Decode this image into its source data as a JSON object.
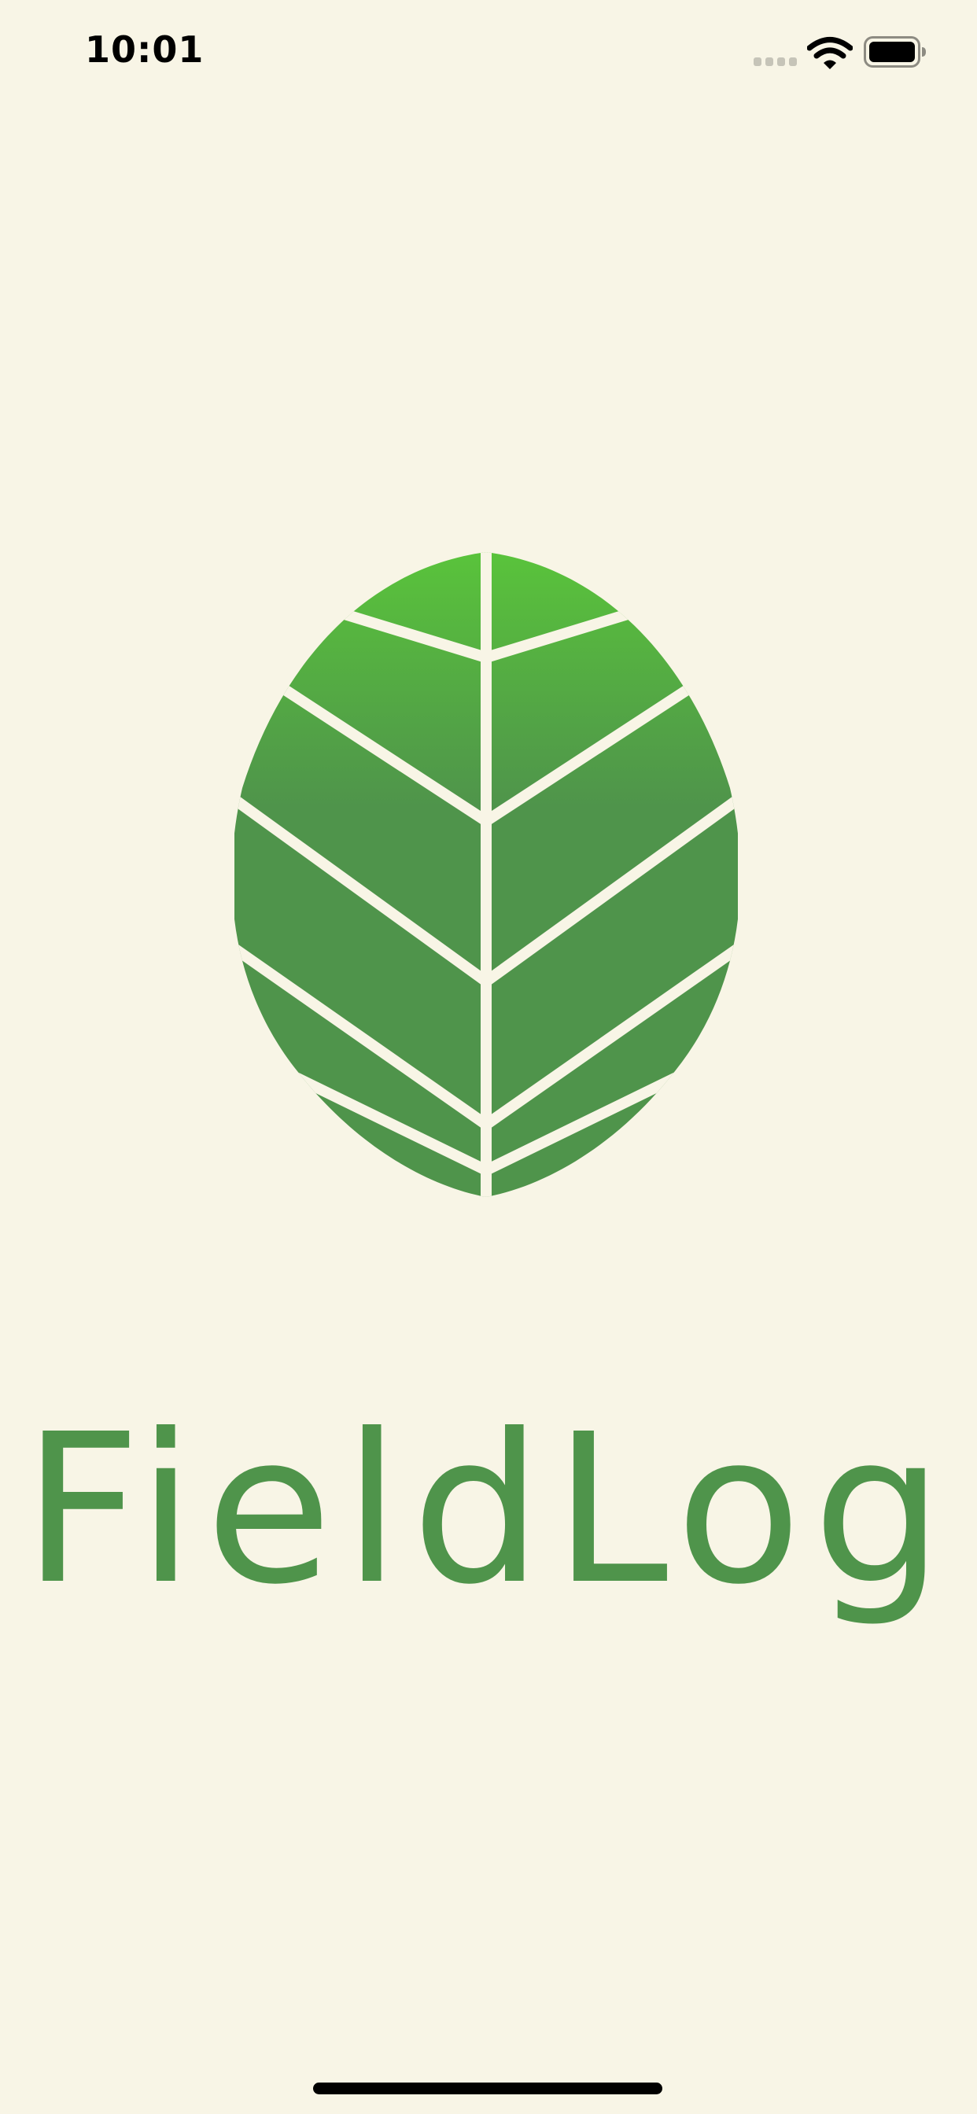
{
  "status_bar": {
    "time": "10:01",
    "icons": [
      "cellular-signal-icon",
      "wifi-icon",
      "battery-icon"
    ]
  },
  "splash": {
    "logo_icon": "leaf-icon",
    "app_name": "FieldLog"
  },
  "colors": {
    "background": "#f8f5e6",
    "brand_green": "#4f944b",
    "leaf_top_green": "#5ac63a",
    "text_dark": "#000000"
  }
}
